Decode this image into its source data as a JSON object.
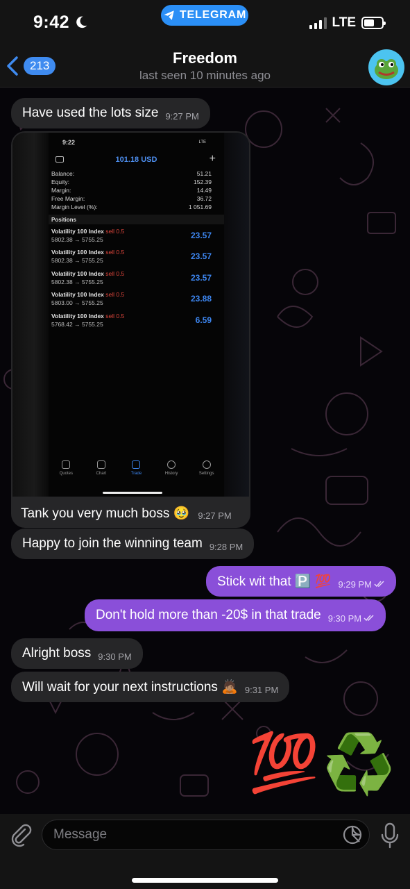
{
  "status_bar": {
    "time": "9:42",
    "app_pill": "TELEGRAM",
    "network": "LTE"
  },
  "header": {
    "back_count": "213",
    "title": "Freedom",
    "subtitle": "last seen 10 minutes ago"
  },
  "messages": [
    {
      "dir": "in",
      "text": "Have used the lots size",
      "time": "9:27 PM"
    },
    {
      "dir": "in",
      "text": "Tank you very much boss 🥹",
      "time": "9:27 PM"
    },
    {
      "dir": "in",
      "text": "Happy to join the winning team",
      "time": "9:28 PM"
    },
    {
      "dir": "out",
      "text": "Stick wit that 🅿️ 💯",
      "time": "9:29 PM"
    },
    {
      "dir": "out",
      "text": "Don't hold more than -20$ in that trade",
      "time": "9:30 PM"
    },
    {
      "dir": "in",
      "text": "Alright boss",
      "time": "9:30 PM"
    },
    {
      "dir": "in",
      "text": "Will wait for your next instructions 🙇🏽",
      "time": "9:31 PM"
    }
  ],
  "screenshot": {
    "time": "9:22",
    "network": "LTE",
    "title": "101.18 USD",
    "summary": [
      {
        "label": "Balance:",
        "value": "51.21"
      },
      {
        "label": "Equity:",
        "value": "152.39"
      },
      {
        "label": "Margin:",
        "value": "14.49"
      },
      {
        "label": "Free Margin:",
        "value": "36.72"
      },
      {
        "label": "Margin Level (%):",
        "value": "1 051.69"
      }
    ],
    "positions_label": "Positions",
    "positions": [
      {
        "symbol": "Volatility 100 Index",
        "side": "sell 0.5",
        "prices": "5802.38 → 5755.25",
        "profit": "23.57"
      },
      {
        "symbol": "Volatility 100 Index",
        "side": "sell 0.5",
        "prices": "5802.38 → 5755.25",
        "profit": "23.57"
      },
      {
        "symbol": "Volatility 100 Index",
        "side": "sell 0.5",
        "prices": "5802.38 → 5755.25",
        "profit": "23.57"
      },
      {
        "symbol": "Volatility 100 Index",
        "side": "sell 0.5",
        "prices": "5803.00 → 5755.25",
        "profit": "23.88"
      },
      {
        "symbol": "Volatility 100 Index",
        "side": "sell 0.5",
        "prices": "5768.42 → 5755.25",
        "profit": "6.59"
      }
    ],
    "tabs": [
      "Quotes",
      "Chart",
      "Trade",
      "History",
      "Settings"
    ]
  },
  "stickers": [
    "💯",
    "♻️"
  ],
  "composer": {
    "placeholder": "Message"
  },
  "colors": {
    "incoming_bubble": "#262628",
    "outgoing_bubble": "#8a4fd9",
    "accent": "#2b8ff6",
    "profit": "#3d86f0",
    "sell": "#e0463c"
  }
}
